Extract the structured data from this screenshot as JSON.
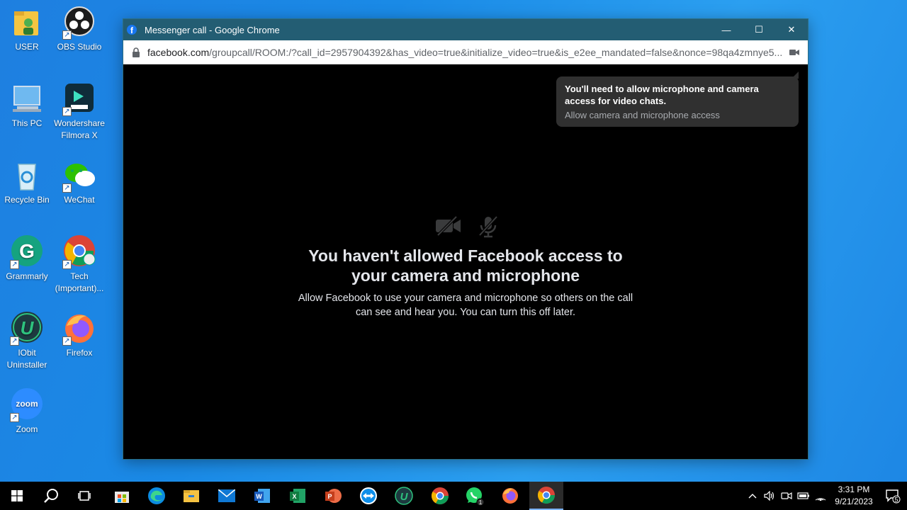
{
  "desktop": {
    "icons": [
      {
        "label": "USER"
      },
      {
        "label": "OBS Studio"
      },
      {
        "label": "This PC"
      },
      {
        "label": "Wondershare Filmora X"
      },
      {
        "label": "Recycle Bin"
      },
      {
        "label": "WeChat"
      },
      {
        "label": "Grammarly"
      },
      {
        "label": "Tech (Important)..."
      },
      {
        "label": "IObit Uninstaller"
      },
      {
        "label": "Firefox"
      },
      {
        "label": "Zoom"
      }
    ]
  },
  "window": {
    "title": "Messenger call - Google Chrome",
    "url_domain": "facebook.com",
    "url_path": "/groupcall/ROOM:/?call_id=2957904392&has_video=true&initialize_video=true&is_e2ee_mandated=false&nonce=98qa4zmnye5...",
    "controls": {
      "minimize": "—",
      "maximize": "☐",
      "close": "✕"
    }
  },
  "tooltip": {
    "title": "You'll need to allow microphone and camera access for video chats.",
    "subtitle": "Allow camera and microphone access"
  },
  "message": {
    "headline_line1": "You haven't allowed Facebook access to",
    "headline_line2": "your camera and microphone",
    "body_line1": "Allow Facebook to use your camera and microphone so others on the call",
    "body_line2": "can see and hear you. You can turn this off later."
  },
  "taskbar": {
    "apps": [
      "start-icon",
      "search-icon",
      "task-view-icon",
      "store-icon",
      "edge-icon",
      "file-explorer-icon",
      "mail-icon",
      "word-icon",
      "excel-icon",
      "powerpoint-icon",
      "teamviewer-icon",
      "iobit-icon",
      "chrome-icon",
      "whatsapp-icon",
      "firefox-icon",
      "chrome-active-icon"
    ],
    "whatsapp_badge": "1",
    "time": "3:31 PM",
    "date": "9/21/2023",
    "notification_count": "5"
  },
  "colors": {
    "titlebar": "#235d73",
    "facebook_blue": "#1877f2",
    "desktop_blue": "#1a8ae6"
  }
}
